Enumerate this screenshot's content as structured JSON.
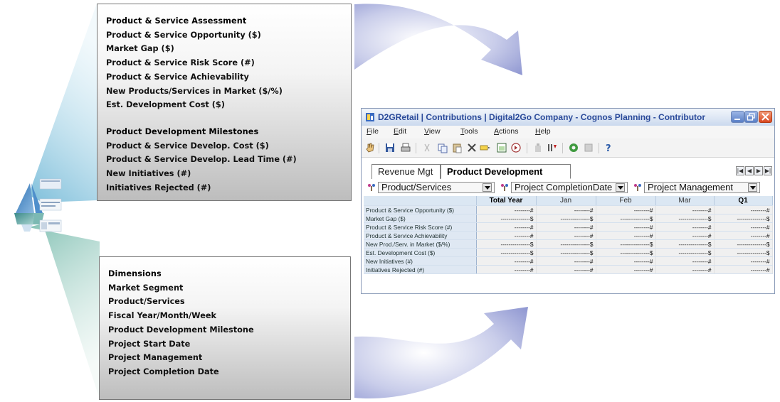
{
  "assessment_panel": {
    "heading": "Product & Service Assessment",
    "items": [
      "Product & Service Opportunity ($)",
      "Market Gap ($)",
      "Product & Service Risk Score (#)",
      "Product & Service Achievability",
      "New Products/Services in Market ($/%)",
      "Est. Development Cost ($)"
    ],
    "milestones_heading": "Product Development Milestones",
    "milestones": [
      "Product & Service Develop. Cost ($)",
      "Product & Service Develop. Lead Time (#)",
      "New Initiatives (#)",
      "Initiatives Rejected (#)"
    ]
  },
  "dimensions_panel": {
    "heading": "Dimensions",
    "items": [
      "Market Segment",
      "Product/Services",
      "Fiscal Year/Month/Week",
      "Product Development Milestone",
      "Project Start Date",
      "Project Management",
      "Project Completion Date"
    ]
  },
  "window": {
    "title": "D2GRetail | Contributions | Digital2Go Company - Cognos Planning - Contributor",
    "menu": [
      {
        "key": "F",
        "rest": "ile"
      },
      {
        "key": "E",
        "rest": "dit"
      },
      {
        "key": "V",
        "rest": "iew"
      },
      {
        "key": "T",
        "rest": "ools"
      },
      {
        "key": "A",
        "rest": "ctions"
      },
      {
        "key": "H",
        "rest": "elp"
      }
    ],
    "tabs": [
      "Revenue Mgt",
      "Product Development"
    ],
    "dimensions": [
      "Product/Services",
      "Project CompletionDate",
      "Project Management"
    ],
    "accent_color": "#2a4a9a"
  },
  "grid": {
    "columns": [
      "Total Year",
      "Jan",
      "Feb",
      "Mar",
      "Q1"
    ],
    "rows": [
      {
        "label": "Product & Service Opportunity ($)",
        "values": [
          "--------#",
          "--------#",
          "--------#",
          "--------#",
          "--------#"
        ]
      },
      {
        "label": "Market Gap ($)",
        "values": [
          "---------------$",
          "---------------$",
          "---------------$",
          "---------------$",
          "---------------$"
        ]
      },
      {
        "label": "Product & Service Risk Score (#)",
        "values": [
          "--------#",
          "--------#",
          "--------#",
          "--------#",
          "--------#"
        ]
      },
      {
        "label": "Product & Service Achievability",
        "values": [
          "--------#",
          "--------#",
          "--------#",
          "--------#",
          "--------#"
        ]
      },
      {
        "label": "New Prod./Serv. in Market ($/%)",
        "values": [
          "---------------$",
          "---------------$",
          "---------------$",
          "---------------$",
          "---------------$"
        ]
      },
      {
        "label": "Est. Development Cost ($)",
        "values": [
          "---------------$",
          "---------------$",
          "---------------$",
          "---------------$",
          "---------------$"
        ]
      },
      {
        "label": "New Initiatives (#)",
        "values": [
          "--------#",
          "--------#",
          "--------#",
          "--------#",
          "--------#"
        ]
      },
      {
        "label": "Initiatives Rejected (#)",
        "values": [
          "--------#",
          "--------#",
          "--------#",
          "--------#",
          "--------#"
        ]
      }
    ]
  }
}
